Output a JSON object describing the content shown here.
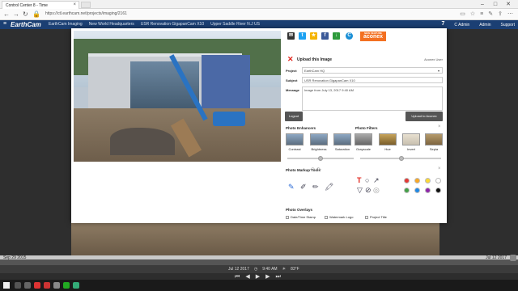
{
  "browser": {
    "tab_title": "Control Center 8 - Time",
    "url": "https://ctl.earthcam.net/projects/imaging/2161",
    "window_controls": [
      "–",
      "□",
      "✕"
    ]
  },
  "header": {
    "logo": "EarthCam",
    "breadcrumbs": [
      "EarthCam Imaging",
      "New World Headquarters",
      "USR Renovation GigapanCam X10",
      "Upper Saddle River N.J US"
    ],
    "badge": "7",
    "right_items": [
      "C Admin",
      "Admin",
      "Support"
    ]
  },
  "timeline": {
    "start_date": "Sep 29 2015",
    "end_date": "Jul 12 2017",
    "current_date": "Jul 12 2017",
    "current_time": "9:40 AM",
    "temperature": "83°F"
  },
  "modal": {
    "share_icons": [
      {
        "name": "email-icon",
        "glyph": "✉",
        "color": "#333333"
      },
      {
        "name": "twitter-icon",
        "glyph": "t",
        "color": "#1da1f2"
      },
      {
        "name": "star-icon",
        "glyph": "★",
        "color": "#f5b400"
      },
      {
        "name": "facebook-icon",
        "glyph": "f",
        "color": "#3b5998"
      },
      {
        "name": "download-icon",
        "glyph": "↓",
        "color": "#2e9b3c"
      },
      {
        "name": "aconex-circle-icon",
        "glyph": "C",
        "color": "#1a8fd6"
      }
    ],
    "aconex": {
      "new_feature": "NEW FEATURE",
      "brand": "aconex"
    },
    "upload": {
      "title": "Upload this Image",
      "user": "Aconex User",
      "project_label": "Project",
      "project_value": "EarthCam HQ",
      "subject_label": "Subject",
      "subject_value": "USR Renovation GigapanCam X10",
      "message_label": "Message",
      "message_value": "Image from July 13, 2017 9:40 AM",
      "logout": "Logout",
      "upload_btn": "Upload to Aconex"
    },
    "enhancers": {
      "title": "Photo Enhancers",
      "filters_title": "Photo Filters",
      "items": [
        "Contrast",
        "Brightness",
        "Saturation",
        "Grayscale",
        "Hue",
        "Invert",
        "Sepia"
      ]
    },
    "markup": {
      "title": "Photo Markup Tools",
      "colors": [
        "#e53935",
        "#f9a825",
        "#fdd835",
        "#ffffff",
        "#43a047",
        "#1e88e5",
        "#8e24aa",
        "#111111"
      ]
    },
    "overlays": {
      "title": "Photo Overlays",
      "items": [
        "Date/Time Stamp",
        "Watermark Logo",
        "Project Title"
      ]
    }
  }
}
